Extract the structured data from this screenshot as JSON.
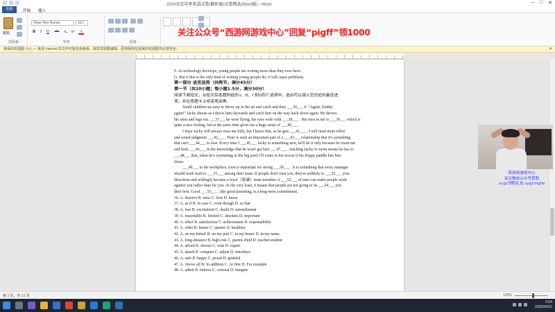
{
  "window": {
    "title": "2024北京中考英语试卷(解析版)试卷精品(Word版) - Word",
    "controls": [
      "–",
      "□",
      "✕"
    ]
  },
  "menu": {
    "tabs": [
      "文件",
      "开始",
      "插入",
      "设计",
      "布局",
      "引用",
      "邮件",
      "审阅",
      "视图"
    ]
  },
  "ribbon": {
    "paste_label": "粘贴",
    "font_name": "Times New Roman",
    "font_size": "10.5",
    "format_buttons": [
      "B",
      "I",
      "U",
      "abc",
      "x₂",
      "x²",
      "A"
    ],
    "group_labels": [
      "剪贴板",
      "字体",
      "段落",
      "样式",
      "编辑"
    ],
    "styles": [
      "正文",
      "无间隔",
      "标题 1",
      "标题 2",
      "标题"
    ],
    "edit_items": [
      "查找",
      "替换",
      "选择"
    ]
  },
  "banner": {
    "text": "关注公众号“西游网游戏中心”回复“pigff”领1000"
  },
  "notification": {
    "text": "受保护的视图 小心 — 来自 Internet 的文件可能包含病毒。除非您需要编辑，否则保持在受保护的视图中比较安全。",
    "close": "✕"
  },
  "document": {
    "lines": [
      {
        "text": "F. As technology develops, young people are writing more than they ever have.",
        "style": ""
      },
      {
        "text": "G. But if this is the only kind of writing young people do, it will cause problems.",
        "style": ""
      },
      {
        "text": "第一部分 语言运用（共两节，满分45分）",
        "style": "bold"
      },
      {
        "text": "第一节（共20小题；每小题1.5分，满分30分）",
        "style": "bold"
      },
      {
        "text": "阅读下面短文，从短文后各题所给的A、B、C和D四个选项中，选出可以填入空白处的最佳选",
        "style": ""
      },
      {
        "text": "项，并在答题卡上将该项涂黑。",
        "style": ""
      },
      {
        "text": "Small children are easy to throw up in the air and catch and they ___36___ it. \"Again, Daddy,",
        "style": "ind"
      },
      {
        "text": "again!\" Jacky shouts as I throw him skywards and catch him on the way back down again. He throws",
        "style": ""
      },
      {
        "text": "his arms and legs out ___37___ he were flying, his eyes wide with ___38___ . His trust in me is ___39___ which is",
        "style": ""
      },
      {
        "text": "quite a nice feeling, but at the same time gives me a huge sense of ___40___ .",
        "style": ""
      },
      {
        "text": "I hope Jacky will always trust me fully, but I know that, as he gets ___41___ , I will need more effort",
        "style": "ind"
      },
      {
        "text": "and sound judgment ___42___ . Trust is such an important part of a ___43___ relationship that it's something",
        "style": ""
      },
      {
        "text": "that can't ___44___ to lose. Every time I ___45___ Jacky to something new, he'll do it only because he trusts me",
        "style": ""
      },
      {
        "text": "and feels ___46___ in the knowledge that he won't get hurt ___47___ , teaching Jacky to swim means he has to",
        "style": ""
      },
      {
        "text": "___48___ that, when he's swimming in the big pool, I'll come to his rescue if his floppy paddle hits him",
        "style": ""
      },
      {
        "text": "down.",
        "style": ""
      },
      {
        "text": "___49___ in the workplace, trust is important for strong ___50___ . It is something that every manager",
        "style": "ind"
      },
      {
        "text": "should work hard to ___51___ among their team. If people don't trust you, they're unlikely to ___52___ your",
        "style": ""
      },
      {
        "text": "directions and willingly become a loyal（忠诚）team member. A ___53___ of trust can make people work",
        "style": ""
      },
      {
        "text": "against you rather than for you. At the very least, it means that people are not going to be ___54___ you",
        "style": ""
      },
      {
        "text": "their best. Good ___55___ , like good parenting, is a long-term commitment.",
        "style": ""
      },
      {
        "text": "36. A. deserve          B. miss          C. love          D. know",
        "style": ""
      },
      {
        "text": "37. A. as if            B. in case         C. even though        D. so that",
        "style": ""
      },
      {
        "text": "38. A. fear            B. excitement       C. doubt            D. astonishment",
        "style": ""
      },
      {
        "text": "39. A. reasonable        B. limited          C. absolute          D. important",
        "style": ""
      },
      {
        "text": "40. A. relief           B. satisfaction       C. achievement        D. responsibility",
        "style": ""
      },
      {
        "text": "41. A. older            B. busier           C. quieter           D. healthier",
        "style": ""
      },
      {
        "text": "42. A. on my behalf      B. on my part       C. in my honor        D. in my name",
        "style": ""
      },
      {
        "text": "43. A. long-distance      B. high-risk        C. parent-child       D. teacher-student",
        "style": ""
      },
      {
        "text": "44. A. afford           B. choose          C. wait              D. expect",
        "style": ""
      },
      {
        "text": "45. A. attach           B. compare         C. adjust            D. introduce",
        "style": ""
      },
      {
        "text": "46. A. safe             B. happy           C. proud             D. grateful",
        "style": ""
      },
      {
        "text": "47. A. Above all         B. In addition       C. At first           D. For example",
        "style": ""
      },
      {
        "text": "48. A. admit            B. believe          C. conceal           D. imagine",
        "style": ""
      }
    ]
  },
  "overlay": {
    "caption_lines": [
      "西游网游戏中心",
      "关注微信公众号获取",
      "xygc领取礼包 xygcmgfw"
    ]
  },
  "statusbar": {
    "zoom": "120%",
    "page_info": "第 3 页，共 12 页"
  },
  "taskbar": {
    "time": "0:04",
    "date": "2025/04/10"
  },
  "colors": {
    "banner": "#ff1a1a",
    "file_tab": "#2b5797",
    "taskbar": "#1d2733",
    "caption": "#3c3cff"
  }
}
